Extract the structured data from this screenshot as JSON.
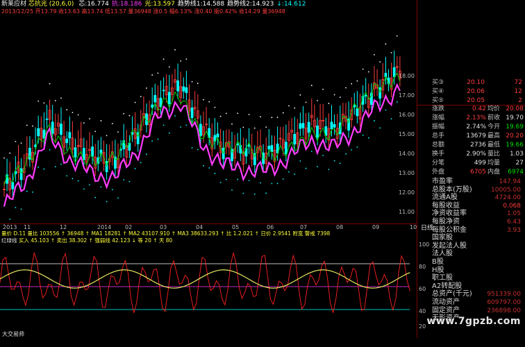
{
  "indicator": {
    "stock_name": "新莱应材",
    "name": "芯抗光 (20,6,0)",
    "line1": [
      {
        "label": "芯",
        "value": "16.774",
        "color": "#ffffff"
      },
      {
        "label": "抗",
        "value": "18.186",
        "color": "#ff3dff"
      },
      {
        "label": "光",
        "value": "13.597",
        "color": "#ffff3a"
      },
      {
        "label": "趋势线1",
        "value": "14.588",
        "color": "#ffffff"
      },
      {
        "label": "趋势线2",
        "value": "14.923",
        "color": "#ffffff"
      },
      {
        "label": "↓",
        "value": "14.612",
        "color": "#00ffff"
      }
    ],
    "line2": "2013/12/25  开13.79 收13.63 高13.74 低13.57 量36948 涨0.5 幅6.13% 涨0.40 振0.42% 收14.29 量36948"
  },
  "price_axis": [
    "18.00",
    "17.00",
    "16.00",
    "15.00",
    "14.00",
    "13.00",
    "12.00",
    "11.00"
  ],
  "date_axis": [
    "2013",
    "11",
    "12",
    "2014",
    "02",
    "03",
    "04",
    "05",
    "06",
    "07",
    "08",
    "09",
    "10"
  ],
  "date_axis_suffix": "日线",
  "volume_indicator": {
    "line": "量价 D.11 量比 103556 ↑ 36948 ↑ MA1 18281 ↑ MA2 43107.910 ↑ MA3 38633.293 ↑ 比 1.2.021 ↑ 日价 2.9541 附宽 警戒 7398"
  },
  "sub_indicator": {
    "name": "红绿线",
    "line": "买入 45.103 ↑ 卖出 38.302 ↑ 强弱线 42.123 ↓ 等 20 ↑ 天 80",
    "levels": [
      "100",
      "80",
      "60",
      "40",
      "20"
    ]
  },
  "side_panel": {
    "orderbook": [
      {
        "label": "买③",
        "price": "20.10",
        "vol": "72"
      },
      {
        "label": "买④",
        "price": "20.06",
        "vol": "12"
      },
      {
        "label": "买⑤",
        "price": "20.05",
        "vol": "2"
      }
    ],
    "quote": [
      {
        "k1": "涨跌",
        "v1": "0.42",
        "c1": "red",
        "k2": "均价",
        "v2": "20.08",
        "c2": "red"
      },
      {
        "k1": "涨幅",
        "v1": "2.13%",
        "c1": "red",
        "k2": "前收",
        "v2": "19.70",
        "c2": "white"
      },
      {
        "k1": "振幅",
        "v1": "2.74%",
        "c1": "white",
        "k2": "今开",
        "v2": "19.69",
        "c2": "green"
      },
      {
        "k1": "总手",
        "v1": "13679",
        "c1": "white",
        "k2": "最高",
        "v2": "20.20",
        "c2": "red"
      },
      {
        "k1": "总额",
        "v1": "2736",
        "c1": "white",
        "k2": "最低",
        "v2": "19.66",
        "c2": "green"
      },
      {
        "k1": "换手",
        "v1": "2.90%",
        "c1": "white",
        "k2": "量比",
        "v2": "1.03",
        "c2": "white"
      },
      {
        "k1": "分笔",
        "v1": "499",
        "c1": "white",
        "k2": "均量",
        "v2": "27",
        "c2": "white"
      },
      {
        "k1": "外盘",
        "v1": "6705",
        "c1": "red",
        "k2": "内盘",
        "v2": "6974",
        "c2": "green"
      }
    ],
    "fundamentals": [
      {
        "k": "市盈率",
        "v": "147.94"
      },
      {
        "k": "总股本(万股)",
        "v": "10005.00"
      },
      {
        "k": "流通A股",
        "v": "4724.00"
      },
      {
        "k": "每股收益",
        "v": "0.068"
      },
      {
        "k": "净资收益率",
        "v": "1.05"
      },
      {
        "k": "每股净资",
        "v": "6.43"
      },
      {
        "k": "每股公积金",
        "v": "3.93"
      },
      {
        "k": "国家股",
        "v": ""
      },
      {
        "k": "发起法人股",
        "v": ""
      },
      {
        "k": "法人股",
        "v": ""
      },
      {
        "k": "B股",
        "v": ""
      },
      {
        "k": "H股",
        "v": ""
      },
      {
        "k": "职工股",
        "v": ""
      },
      {
        "k": "A2转配股",
        "v": ""
      },
      {
        "k": "总资产(千元)",
        "v": "951339.00"
      },
      {
        "k": "流动资产",
        "v": "609797.00"
      },
      {
        "k": "固定资产",
        "v": "236898.00"
      },
      {
        "k": "无形资产",
        "v": ""
      }
    ]
  },
  "footer": {
    "left": "大交易师",
    "watermark": "www.7gpzb.com"
  },
  "colors": {
    "up": "#ff3d3d",
    "down": "#00e000",
    "band": "#ff3dff",
    "support": "#00ffff",
    "ma": "#00d000",
    "sub_red": "#ff2020",
    "sub_green": "#20e020",
    "sub_yellow": "#e8e860"
  }
}
